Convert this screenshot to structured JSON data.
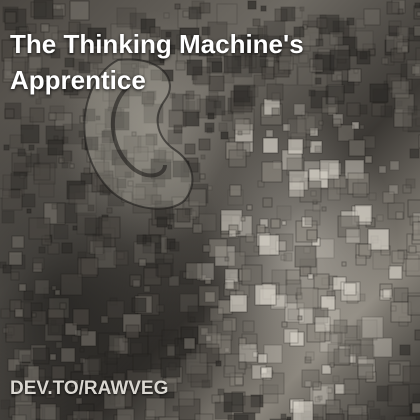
{
  "card": {
    "title": "The Thinking Machine's Apprentice",
    "footer": "DEV.TO/RAWVEG"
  },
  "image": {
    "subject": "pixelated stone head with ear",
    "palette": [
      "#2e2c29",
      "#4a4641",
      "#6e6a63",
      "#8a857c",
      "#d8d3c9"
    ]
  }
}
